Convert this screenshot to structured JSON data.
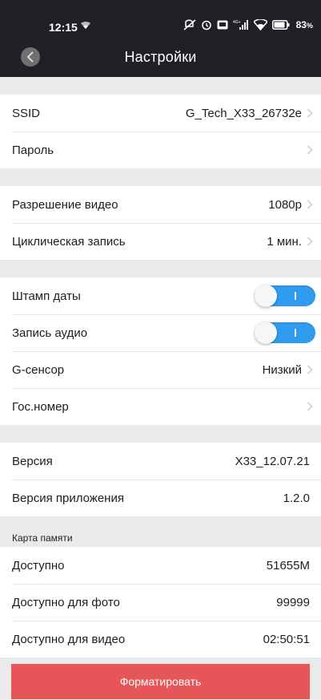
{
  "status_bar": {
    "time": "12:15",
    "battery": "83"
  },
  "header": {
    "title": "Настройки"
  },
  "groups": {
    "network": [
      {
        "label": "SSID",
        "value": "G_Tech_X33_26732e"
      },
      {
        "label": "Пароль",
        "value": ""
      }
    ],
    "video": [
      {
        "label": "Разрешение видео",
        "value": "1080p"
      },
      {
        "label": "Циклическая запись",
        "value": "1 мин."
      }
    ],
    "options": [
      {
        "label": "Штамп даты",
        "toggle": true
      },
      {
        "label": "Запись аудио",
        "toggle": true
      },
      {
        "label": "G-сенсор",
        "value": "Низкий"
      },
      {
        "label": "Гос.номер",
        "value": ""
      }
    ],
    "about": [
      {
        "label": "Версия",
        "value": "X33_12.07.21"
      },
      {
        "label": "Версия приложения",
        "value": "1.2.0"
      }
    ],
    "memory_title": "Карта памяти",
    "memory": [
      {
        "label": "Доступно",
        "value": "51655M"
      },
      {
        "label": "Доступно для фото",
        "value": "99999"
      },
      {
        "label": "Доступно для видео",
        "value": "02:50:51"
      }
    ]
  },
  "format_button": "Форматировать",
  "colors": {
    "header_bg": "#202124",
    "toggle_on": "#2f9cf0",
    "format_button": "#e65658"
  }
}
